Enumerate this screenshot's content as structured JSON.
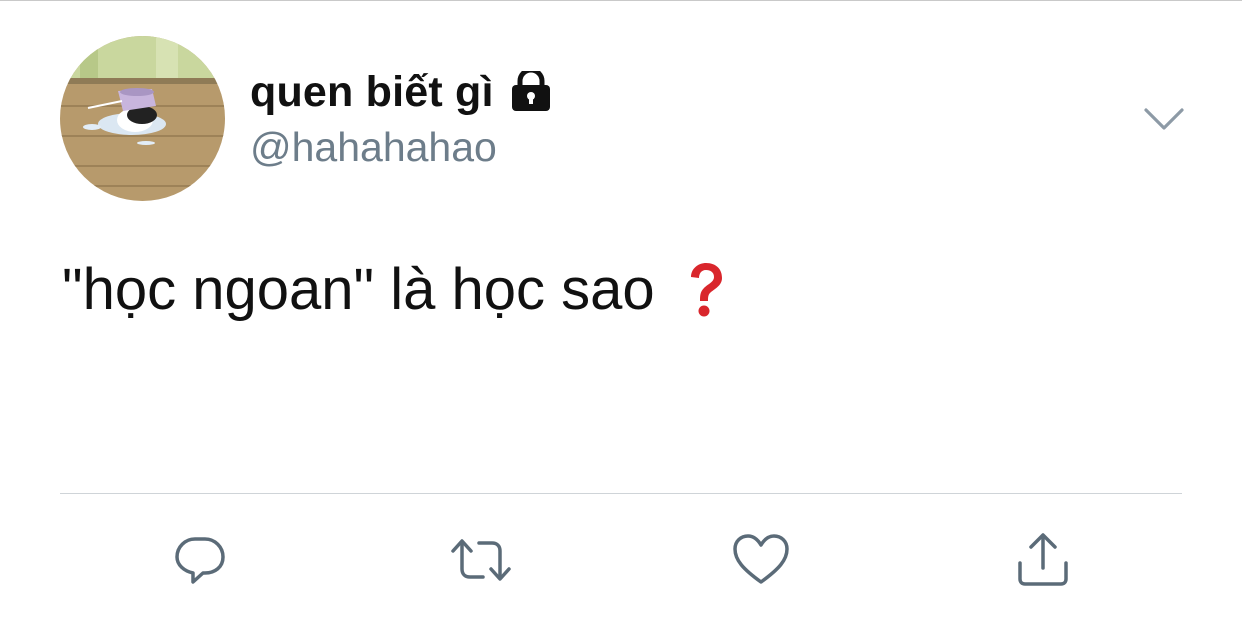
{
  "tweet": {
    "display_name": "quen biết gì",
    "handle": "@hahahahao",
    "text": "\"học ngoan\" là học sao",
    "protected_icon": "lock-icon",
    "emoji_icon": "red-question-mark-icon"
  },
  "actions": [
    {
      "name": "reply",
      "icon": "reply-bubble-icon"
    },
    {
      "name": "retweet",
      "icon": "retweet-icon"
    },
    {
      "name": "like",
      "icon": "heart-icon"
    },
    {
      "name": "share",
      "icon": "share-upload-icon"
    }
  ],
  "colors": {
    "text": "#111111",
    "handle": "#6d7d8a",
    "icon": "#5b6b78",
    "divider": "#cfd4d8",
    "question_mark": "#d9262c"
  }
}
